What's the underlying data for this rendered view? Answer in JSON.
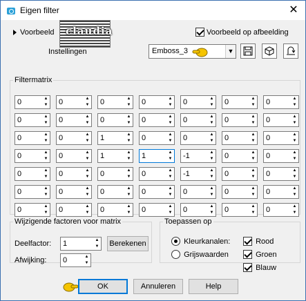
{
  "window": {
    "title": "Eigen filter",
    "close_glyph": "✕"
  },
  "preview": {
    "label": "Voorbeeld",
    "instellingen": "Instellingen",
    "logo_text": "claudia",
    "checkbox_label": "Voorbeeld op afbeelding",
    "checkbox_checked": true
  },
  "preset": {
    "value": "Emboss_3"
  },
  "icons": [
    "save-preset-icon",
    "cube-icon",
    "reset-icon"
  ],
  "matrix": {
    "legend": "Filtermatrix",
    "rows": [
      [
        "0",
        "0",
        "0",
        "0",
        "0",
        "0",
        "0"
      ],
      [
        "0",
        "0",
        "0",
        "0",
        "0",
        "0",
        "0"
      ],
      [
        "0",
        "0",
        "1",
        "0",
        "0",
        "0",
        "0"
      ],
      [
        "0",
        "0",
        "1",
        "1",
        "-1",
        "0",
        "0"
      ],
      [
        "0",
        "0",
        "0",
        "0",
        "-1",
        "0",
        "0"
      ],
      [
        "0",
        "0",
        "0",
        "0",
        "0",
        "0",
        "0"
      ],
      [
        "0",
        "0",
        "0",
        "0",
        "0",
        "0",
        "0"
      ]
    ]
  },
  "factors": {
    "legend": "Wijzigende factoren voor matrix",
    "divisor_label": "Deelfactor:",
    "divisor_value": "1",
    "compute_label": "Berekenen",
    "bias_label": "Afwijking:",
    "bias_value": "0"
  },
  "apply": {
    "legend": "Toepassen op",
    "color_channels": "Kleurkanalen:",
    "grayscale": "Grijswaarden",
    "red": "Rood",
    "green": "Groen",
    "blue": "Blauw"
  },
  "buttons": {
    "ok": "OK",
    "cancel": "Annuleren",
    "help": "Help"
  },
  "colors": {
    "accent": "#0078d7",
    "pointer": "#f5c400"
  }
}
